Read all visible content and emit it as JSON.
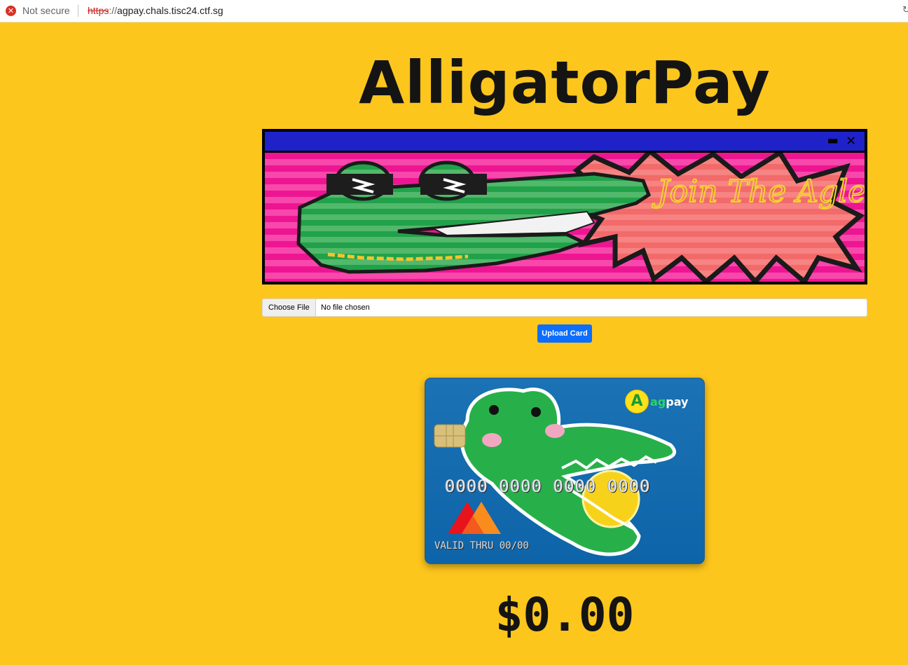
{
  "browser": {
    "security_label": "Not secure",
    "url_scheme": "https",
    "url_separator": "://",
    "url_host": "agpay.chals.tisc24.ctf.sg",
    "icons": {
      "security": "error-circle-icon",
      "reload": "reload-icon"
    }
  },
  "page": {
    "title": "AlligatorPay",
    "background_color": "#fdc61c"
  },
  "banner": {
    "text": "Join The Agleets",
    "colors": {
      "titlebar": "#1f22c8",
      "background": "#e8148f",
      "alligator": "#1f9e45",
      "burst": "#f06a6a"
    },
    "icons": {
      "minimize": "minimize-icon",
      "close": "close-x-icon"
    }
  },
  "upload": {
    "choose_file_label": "Choose File",
    "no_file_text": "No file chosen",
    "upload_button_label": "Upload Card",
    "button_color": "#0d6efd"
  },
  "card": {
    "brand_prefix": "ag",
    "brand_suffix": "pay",
    "brand_coin_letter": "A",
    "number": "0000 0000 0000 0000",
    "valid_thru": "VALID THRU 00/00",
    "card_color": "#0e64a8"
  },
  "balance": {
    "amount": "$0.00"
  }
}
